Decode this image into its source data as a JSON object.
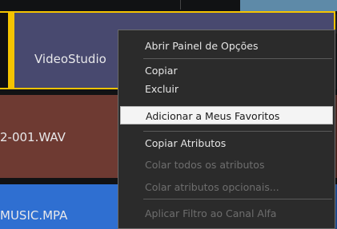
{
  "timeline": {
    "video_clip": "VideoStudio",
    "audio_clip": "2-001.WAV",
    "music_clip": "MUSIC.MPA"
  },
  "context_menu": {
    "items": [
      {
        "label": "Abrir Painel de Opções",
        "enabled": true
      },
      {
        "label": "Copiar",
        "enabled": true
      },
      {
        "label": "Excluir",
        "enabled": true
      },
      {
        "label": "Adicionar a Meus Favoritos",
        "enabled": true,
        "highlighted": true
      },
      {
        "label": "Copiar Atributos",
        "enabled": true
      },
      {
        "label": "Colar todos os atributos",
        "enabled": false
      },
      {
        "label": "Colar atributos opcionais...",
        "enabled": false
      },
      {
        "label": "Aplicar Filtro ao Canal Alfa",
        "enabled": false
      }
    ]
  },
  "colors": {
    "video_clip_bg": "#48496f",
    "selection_border": "#f5c400",
    "audio_clip_bg": "#6e3a32",
    "music_clip_bg": "#2f6fd1",
    "menu_bg": "#2b2b2b",
    "menu_highlight": "#f4f4f4"
  }
}
